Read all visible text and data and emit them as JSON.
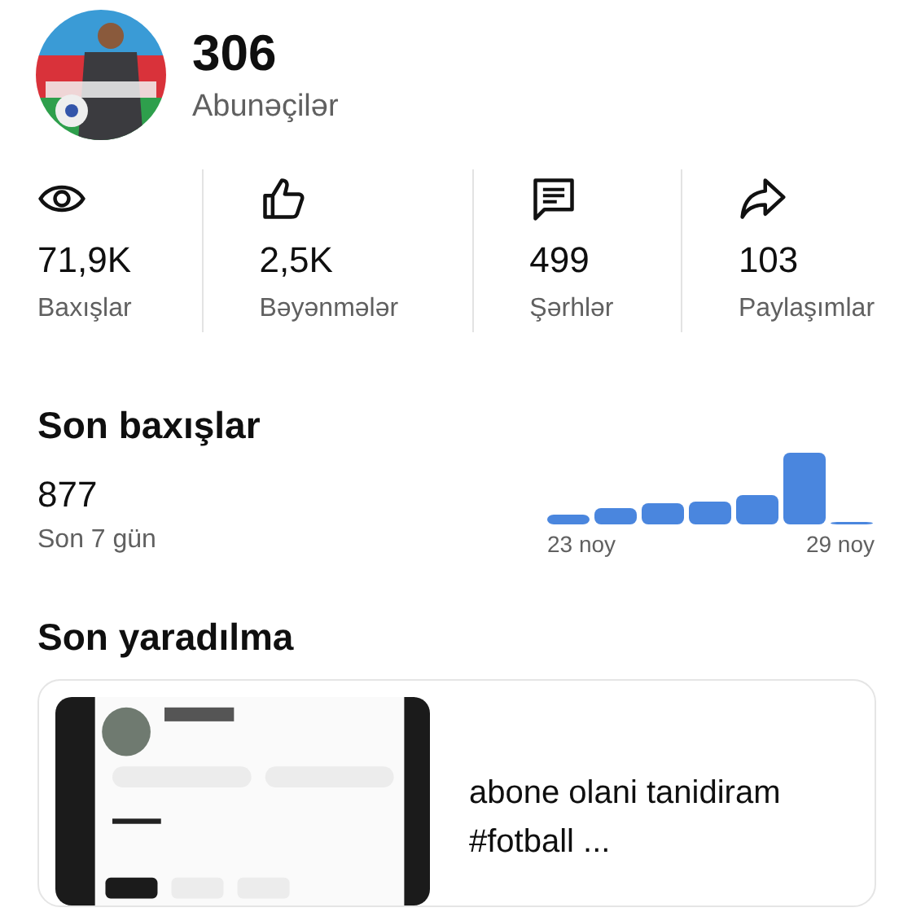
{
  "channel": {
    "subscribers": "306",
    "subscribers_label": "Abunəçilər"
  },
  "stats": [
    {
      "kind": "views",
      "value": "71,9K",
      "label": "Baxışlar"
    },
    {
      "kind": "likes",
      "value": "2,5K",
      "label": "Bəyənmələr"
    },
    {
      "kind": "comments",
      "value": "499",
      "label": "Şərhlər"
    },
    {
      "kind": "shares",
      "value": "103",
      "label": "Paylaşımlar"
    }
  ],
  "recent_views": {
    "title": "Son baxışlar",
    "value": "877",
    "period": "Son 7 gün",
    "axis_start": "23 noy",
    "axis_end": "29 noy"
  },
  "latest": {
    "title": "Son yaradılma",
    "video_title": "abone olani tanidiram #fotball ..."
  }
}
